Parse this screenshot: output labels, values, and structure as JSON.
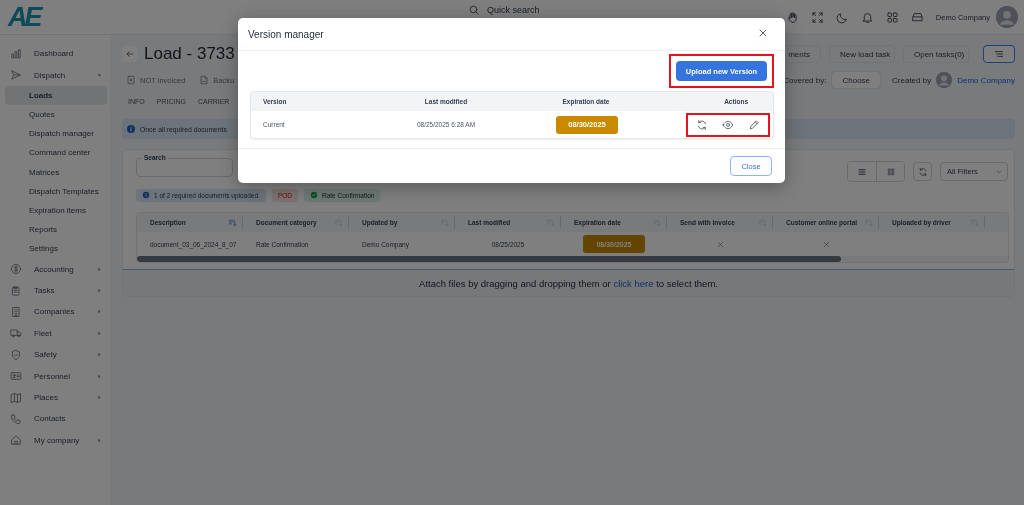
{
  "top_bar": {
    "logo": "AE",
    "search_placeholder": "Quick search",
    "user_name": "Demo Company"
  },
  "sidebar": {
    "items": [
      {
        "label": "Dashboard",
        "expandable": false
      },
      {
        "label": "Dispatch",
        "expandable": true,
        "expanded": true,
        "children": [
          {
            "label": "Loads",
            "selected": true
          },
          {
            "label": "Quotes",
            "selected": false
          },
          {
            "label": "Dispatch manager",
            "selected": false
          },
          {
            "label": "Command center",
            "selected": false
          },
          {
            "label": "Matrices",
            "selected": false
          },
          {
            "label": "Dispatch Templates",
            "selected": false
          },
          {
            "label": "Expiration items",
            "selected": false
          },
          {
            "label": "Reports",
            "selected": false
          },
          {
            "label": "Settings",
            "selected": false
          }
        ]
      },
      {
        "label": "Accounting",
        "expandable": true,
        "expanded": false
      },
      {
        "label": "Tasks",
        "expandable": true,
        "expanded": false
      },
      {
        "label": "Companies",
        "expandable": true,
        "expanded": false
      },
      {
        "label": "Fleet",
        "expandable": true,
        "expanded": false
      },
      {
        "label": "Safety",
        "expandable": true,
        "expanded": false
      },
      {
        "label": "Personnel",
        "expandable": true,
        "expanded": false
      },
      {
        "label": "Places",
        "expandable": true,
        "expanded": false
      },
      {
        "label": "Contacts",
        "expandable": false
      },
      {
        "label": "My company",
        "expandable": true,
        "expanded": false
      }
    ]
  },
  "header": {
    "title": "Load - 3733",
    "actions": [
      "ments",
      "New load task",
      "Open tasks(0)"
    ],
    "status": [
      "NOT invoiced",
      "Backu"
    ],
    "covered_by_label": "Covered by:",
    "covered_by_button": "Choose",
    "created_by_label": "Created by",
    "created_by_name": "Demo Company"
  },
  "tabs": [
    {
      "label": "INFO",
      "selected": false
    },
    {
      "label": "PRICING",
      "selected": false
    },
    {
      "label": "CARRIER",
      "selected": false
    }
  ],
  "info_banner": "Once all required documents",
  "documents": {
    "search_label": "Search",
    "views": [
      {
        "kind": "list",
        "selected": true
      },
      {
        "kind": "grid",
        "selected": false
      }
    ],
    "filter": "All Filters",
    "summary": "1 of 2 required documents uploaded.",
    "required": [
      {
        "label": "POD",
        "uploaded": false
      },
      {
        "label": "Rate Confirmation",
        "uploaded": true
      }
    ],
    "columns": [
      {
        "label": "Description",
        "sorted": true
      },
      {
        "label": "Document category",
        "sorted": false
      },
      {
        "label": "Updated by",
        "sorted": false
      },
      {
        "label": "Last modified",
        "sorted": false
      },
      {
        "label": "Expiration date",
        "sorted": false
      },
      {
        "label": "Send with invoice",
        "sorted": false
      },
      {
        "label": "Customer online portal",
        "sorted": false
      },
      {
        "label": "Uploaded by driver",
        "sorted": false
      }
    ],
    "rows": [
      {
        "description": "document_03_06_2024_8_07",
        "category": "Rate Confirmation",
        "updated_by": "Demo Company",
        "last_modified": "08/25/2025",
        "expiration": "08/30/2025",
        "send_with_invoice": false,
        "customer_online_portal": false
      }
    ],
    "drop_text_before": "Attach files by dragging and dropping them or",
    "drop_link": "click here",
    "drop_text_after": "to select them."
  },
  "modal": {
    "title": "Version manager",
    "upload_button": "Upload new Version",
    "columns": [
      "Version",
      "Last modified",
      "Expiration date",
      "Actions"
    ],
    "rows": [
      {
        "version": "Current",
        "last_modified": "08/25/2025 6:28 AM",
        "expiration": "08/30/2025"
      }
    ],
    "close_button": "Close"
  }
}
